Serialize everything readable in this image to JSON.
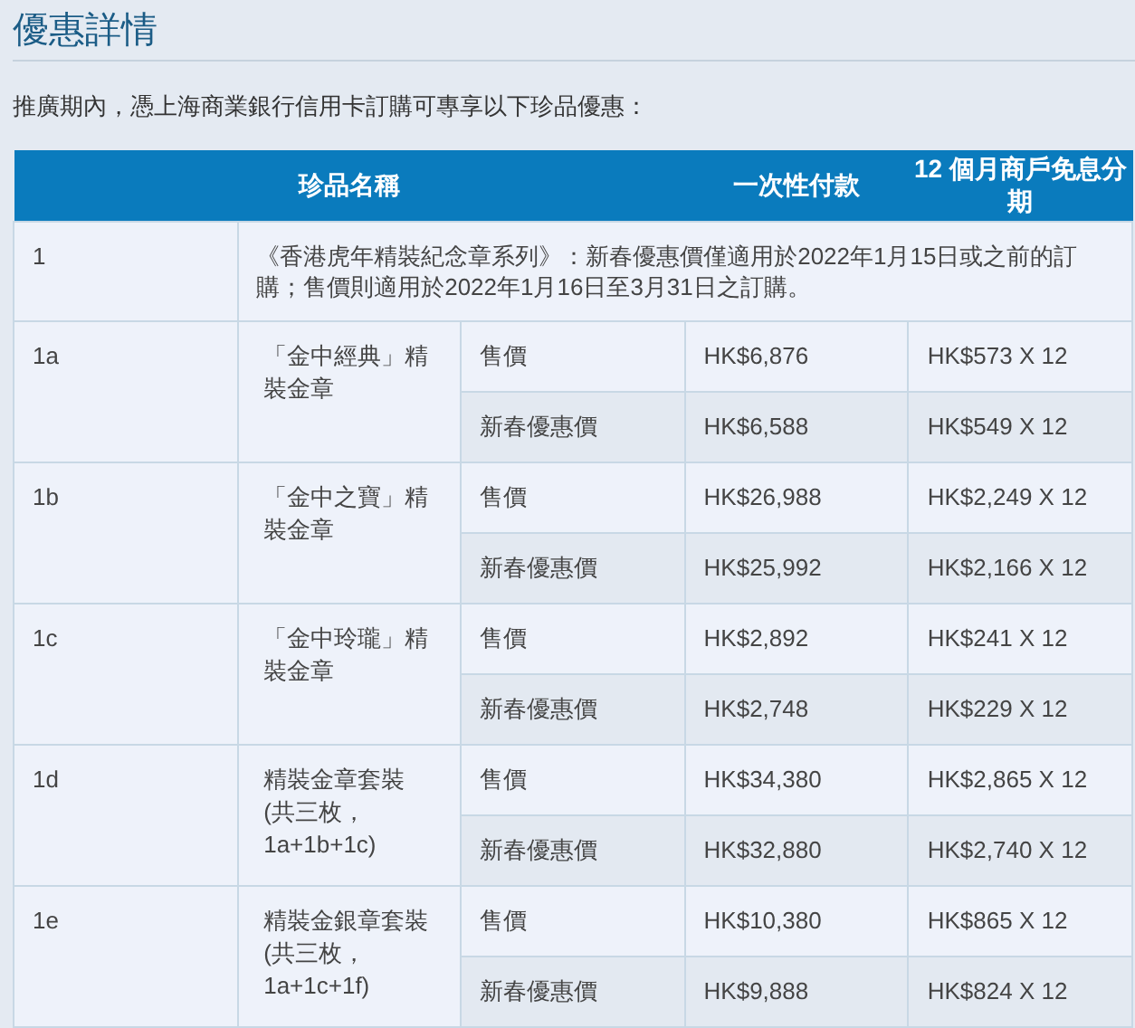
{
  "title": "優惠詳情",
  "intro": "推廣期內，憑上海商業銀行信用卡訂購可專享以下珍品優惠：",
  "table": {
    "columns": [
      "珍品名稱",
      "一次性付款",
      "12 個月商戶免息分期"
    ],
    "note": {
      "code": "1",
      "text": "《香港虎年精裝紀念章系列》：新春優惠價僅適用於2022年1月15日或之前的訂購；售價則適用於2022年1月16日至3月31日之訂購。"
    },
    "items": [
      {
        "code": "1a",
        "name": "「金中經典」精裝金章",
        "prices": [
          {
            "label": "售價",
            "lump_sum": "HK$6,876",
            "installment": "HK$573 X 12"
          },
          {
            "label": "新春優惠價",
            "lump_sum": "HK$6,588",
            "installment": "HK$549 X 12"
          }
        ]
      },
      {
        "code": "1b",
        "name": "「金中之寶」精裝金章",
        "prices": [
          {
            "label": "售價",
            "lump_sum": "HK$26,988",
            "installment": "HK$2,249 X 12"
          },
          {
            "label": "新春優惠價",
            "lump_sum": "HK$25,992",
            "installment": "HK$2,166 X 12"
          }
        ]
      },
      {
        "code": "1c",
        "name": "「金中玲瓏」精裝金章",
        "prices": [
          {
            "label": "售價",
            "lump_sum": "HK$2,892",
            "installment": "HK$241 X 12"
          },
          {
            "label": "新春優惠價",
            "lump_sum": "HK$2,748",
            "installment": "HK$229 X 12"
          }
        ]
      },
      {
        "code": "1d",
        "name": "精裝金章套裝\n(共三枚，1a+1b+1c)",
        "prices": [
          {
            "label": "售價",
            "lump_sum": "HK$34,380",
            "installment": "HK$2,865 X 12"
          },
          {
            "label": "新春優惠價",
            "lump_sum": "HK$32,880",
            "installment": "HK$2,740 X 12"
          }
        ]
      },
      {
        "code": "1e",
        "name": "精裝金銀章套裝\n(共三枚， 1a+1c+1f)",
        "prices": [
          {
            "label": "售價",
            "lump_sum": "HK$10,380",
            "installment": "HK$865 X 12"
          },
          {
            "label": "新春優惠價",
            "lump_sum": "HK$9,888",
            "installment": "HK$824 X 12"
          }
        ]
      }
    ]
  }
}
